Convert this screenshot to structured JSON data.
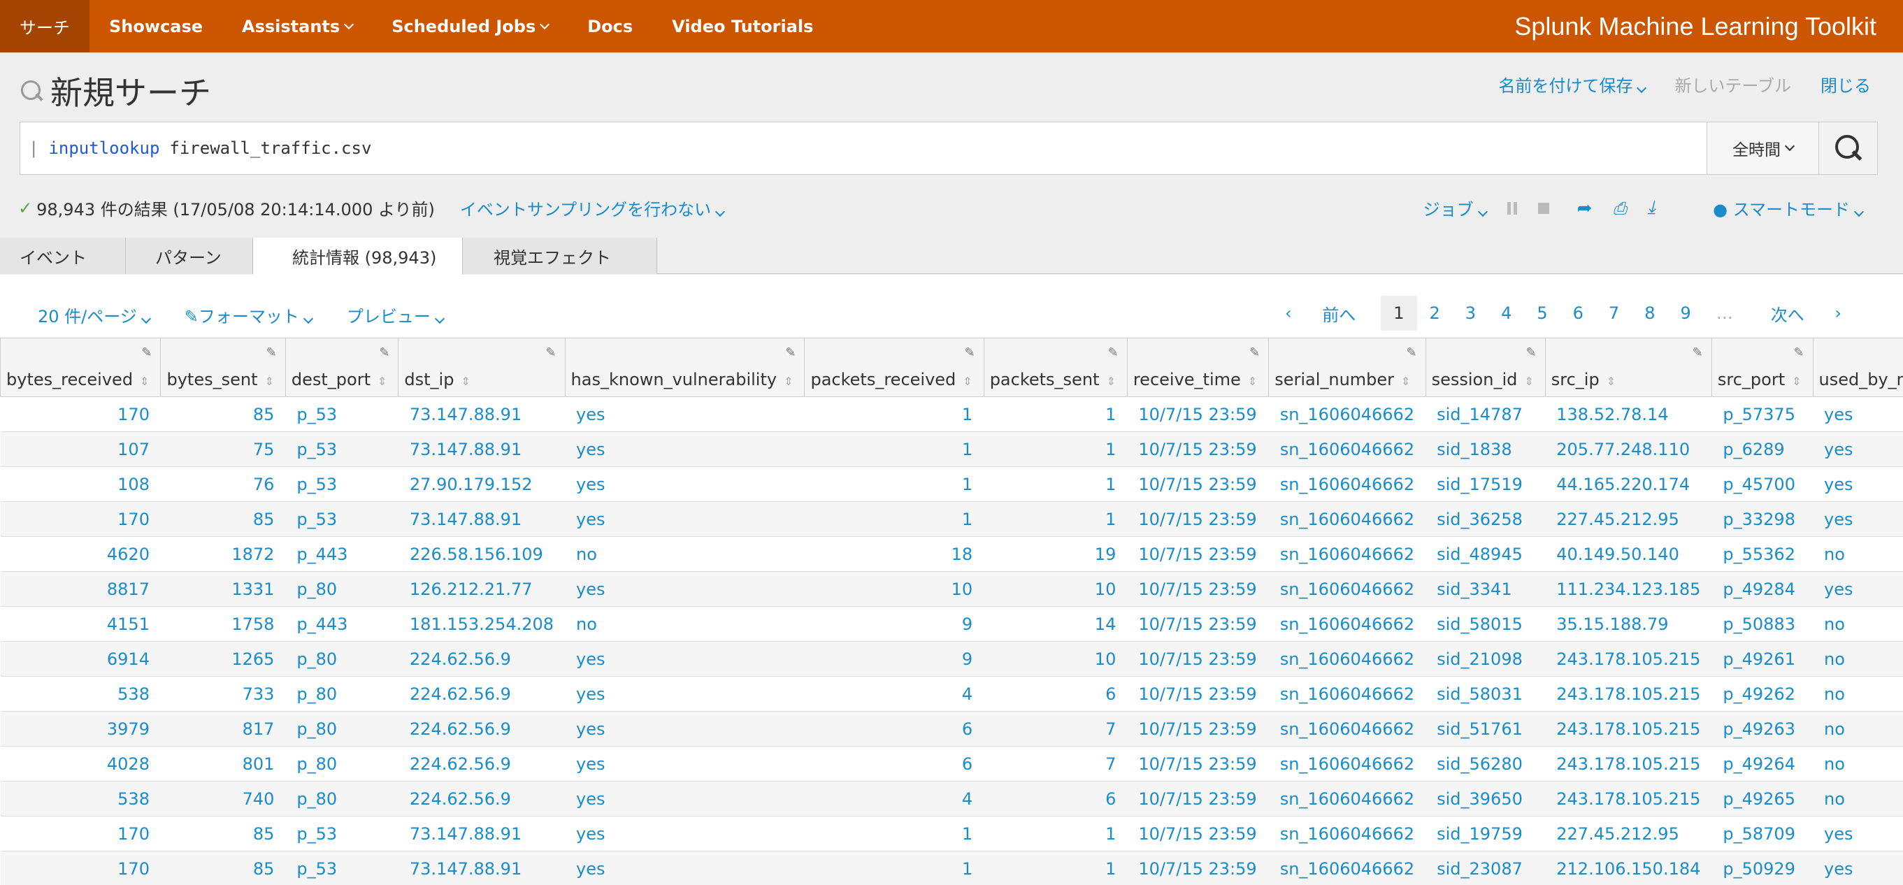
{
  "topnav": {
    "items": [
      {
        "label": "サーチ",
        "active": true,
        "dropdown": false
      },
      {
        "label": "Showcase",
        "dropdown": false
      },
      {
        "label": "Assistants",
        "dropdown": true
      },
      {
        "label": "Scheduled Jobs",
        "dropdown": true
      },
      {
        "label": "Docs",
        "dropdown": false
      },
      {
        "label": "Video Tutorials",
        "dropdown": false
      }
    ],
    "brand": "Splunk Machine Learning Toolkit",
    "color": "#cc5500"
  },
  "title": {
    "text": "新規サーチ",
    "save_as": "名前を付けて保存",
    "new_table": "新しいテーブル",
    "close": "閉じる"
  },
  "search": {
    "pipe": "|",
    "command": "inputlookup",
    "argument": "firewall_traffic.csv",
    "time_range": "全時間"
  },
  "status": {
    "result_text": "98,943 件の結果 (17/05/08 20:14:14.000 より前)",
    "sampling": "イベントサンプリングを行わない",
    "job": "ジョブ",
    "mode": "スマートモード"
  },
  "tabs": [
    {
      "label": "イベント"
    },
    {
      "label": "パターン"
    },
    {
      "label": "統計情報 (98,943)",
      "active": true
    },
    {
      "label": "視覚エフェクト"
    }
  ],
  "toolbar": {
    "per_page": "20 件/ページ",
    "format": "フォーマット",
    "preview": "プレビュー"
  },
  "pager": {
    "prev": "前へ",
    "pages": [
      "1",
      "2",
      "3",
      "4",
      "5",
      "6",
      "7",
      "8",
      "9"
    ],
    "ellipsis": "…",
    "next": "次へ",
    "current": "1"
  },
  "table": {
    "columns": [
      "bytes_received",
      "bytes_sent",
      "dest_port",
      "dst_ip",
      "has_known_vulnerability",
      "packets_received",
      "packets_sent",
      "receive_time",
      "serial_number",
      "session_id",
      "src_ip",
      "src_port",
      "used_by_malware"
    ],
    "rows": [
      [
        "170",
        "85",
        "p_53",
        "73.147.88.91",
        "yes",
        "1",
        "1",
        "10/7/15 23:59",
        "sn_1606046662",
        "sid_14787",
        "138.52.78.14",
        "p_57375",
        "yes"
      ],
      [
        "107",
        "75",
        "p_53",
        "73.147.88.91",
        "yes",
        "1",
        "1",
        "10/7/15 23:59",
        "sn_1606046662",
        "sid_1838",
        "205.77.248.110",
        "p_6289",
        "yes"
      ],
      [
        "108",
        "76",
        "p_53",
        "27.90.179.152",
        "yes",
        "1",
        "1",
        "10/7/15 23:59",
        "sn_1606046662",
        "sid_17519",
        "44.165.220.174",
        "p_45700",
        "yes"
      ],
      [
        "170",
        "85",
        "p_53",
        "73.147.88.91",
        "yes",
        "1",
        "1",
        "10/7/15 23:59",
        "sn_1606046662",
        "sid_36258",
        "227.45.212.95",
        "p_33298",
        "yes"
      ],
      [
        "4620",
        "1872",
        "p_443",
        "226.58.156.109",
        "no",
        "18",
        "19",
        "10/7/15 23:59",
        "sn_1606046662",
        "sid_48945",
        "40.149.50.140",
        "p_55362",
        "no"
      ],
      [
        "8817",
        "1331",
        "p_80",
        "126.212.21.77",
        "yes",
        "10",
        "10",
        "10/7/15 23:59",
        "sn_1606046662",
        "sid_3341",
        "111.234.123.185",
        "p_49284",
        "yes"
      ],
      [
        "4151",
        "1758",
        "p_443",
        "181.153.254.208",
        "no",
        "9",
        "14",
        "10/7/15 23:59",
        "sn_1606046662",
        "sid_58015",
        "35.15.188.79",
        "p_50883",
        "no"
      ],
      [
        "6914",
        "1265",
        "p_80",
        "224.62.56.9",
        "yes",
        "9",
        "10",
        "10/7/15 23:59",
        "sn_1606046662",
        "sid_21098",
        "243.178.105.215",
        "p_49261",
        "no"
      ],
      [
        "538",
        "733",
        "p_80",
        "224.62.56.9",
        "yes",
        "4",
        "6",
        "10/7/15 23:59",
        "sn_1606046662",
        "sid_58031",
        "243.178.105.215",
        "p_49262",
        "no"
      ],
      [
        "3979",
        "817",
        "p_80",
        "224.62.56.9",
        "yes",
        "6",
        "7",
        "10/7/15 23:59",
        "sn_1606046662",
        "sid_51761",
        "243.178.105.215",
        "p_49263",
        "no"
      ],
      [
        "4028",
        "801",
        "p_80",
        "224.62.56.9",
        "yes",
        "6",
        "7",
        "10/7/15 23:59",
        "sn_1606046662",
        "sid_56280",
        "243.178.105.215",
        "p_49264",
        "no"
      ],
      [
        "538",
        "740",
        "p_80",
        "224.62.56.9",
        "yes",
        "4",
        "6",
        "10/7/15 23:59",
        "sn_1606046662",
        "sid_39650",
        "243.178.105.215",
        "p_49265",
        "no"
      ],
      [
        "170",
        "85",
        "p_53",
        "73.147.88.91",
        "yes",
        "1",
        "1",
        "10/7/15 23:59",
        "sn_1606046662",
        "sid_19759",
        "227.45.212.95",
        "p_58709",
        "yes"
      ],
      [
        "170",
        "85",
        "p_53",
        "73.147.88.91",
        "yes",
        "1",
        "1",
        "10/7/15 23:59",
        "sn_1606046662",
        "sid_23087",
        "212.106.150.184",
        "p_50929",
        "yes"
      ]
    ]
  }
}
